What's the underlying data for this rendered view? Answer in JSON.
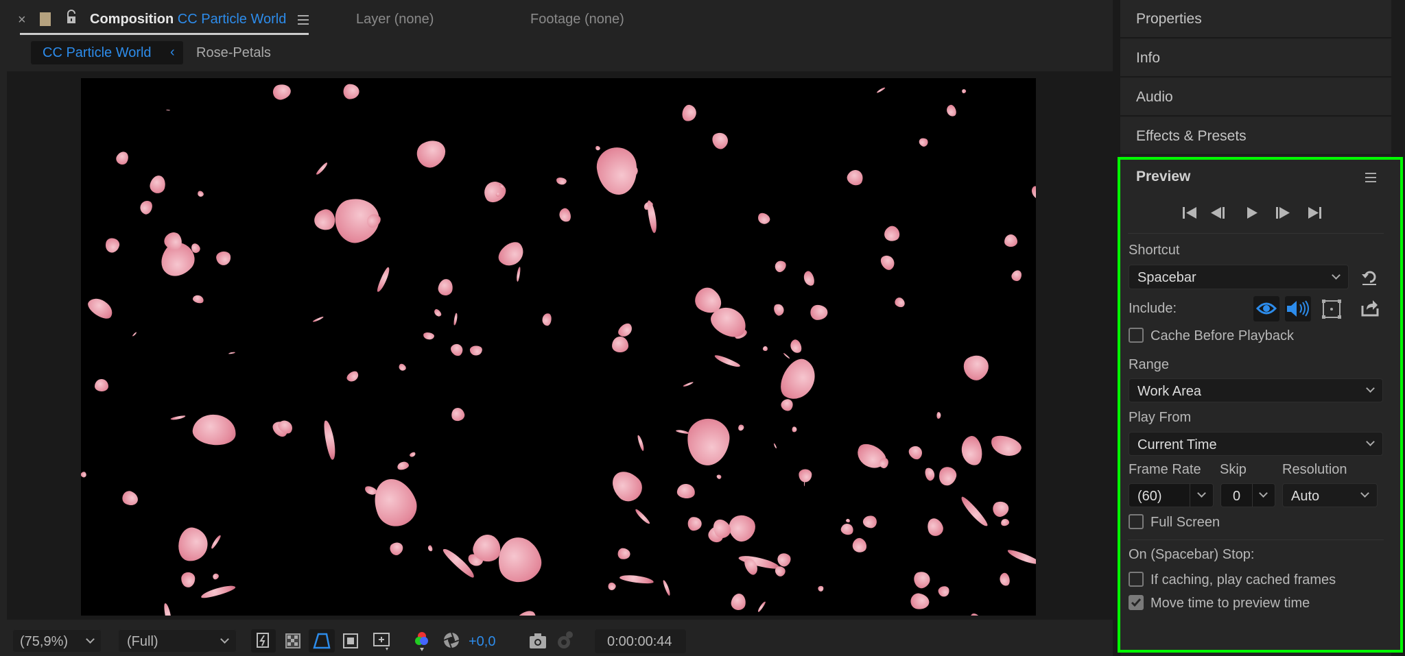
{
  "comp_panel": {
    "close": "×",
    "tab_prefix": "Composition",
    "tab_name": "CC Particle World",
    "layer_tab": "Layer (none)",
    "footage_tab": "Footage (none)",
    "breadcrumbs": [
      "CC Particle World",
      "Rose-Petals"
    ],
    "toolbar": {
      "zoom": "(75,9%)",
      "resolution": "(Full)",
      "exposure": "+0,0",
      "timecode": "0:00:00:44"
    }
  },
  "right_panels": [
    "Properties",
    "Info",
    "Audio",
    "Effects & Presets"
  ],
  "preview": {
    "title": "Preview",
    "shortcut_label": "Shortcut",
    "shortcut_value": "Spacebar",
    "include_label": "Include:",
    "cache_before_playback": {
      "label": "Cache Before Playback",
      "checked": false
    },
    "range_label": "Range",
    "range_value": "Work Area",
    "play_from_label": "Play From",
    "play_from_value": "Current Time",
    "frame_rate_label": "Frame Rate",
    "frame_rate_value": "(60)",
    "skip_label": "Skip",
    "skip_value": "0",
    "resolution_label": "Resolution",
    "resolution_value": "Auto",
    "full_screen": {
      "label": "Full Screen",
      "checked": false
    },
    "on_stop_label": "On (Spacebar) Stop:",
    "if_caching": {
      "label": "If caching, play cached frames",
      "checked": false
    },
    "move_time": {
      "label": "Move time to preview time",
      "checked": true
    }
  },
  "colors": {
    "accent": "#2d8ceb",
    "highlight": "#00ff00"
  }
}
